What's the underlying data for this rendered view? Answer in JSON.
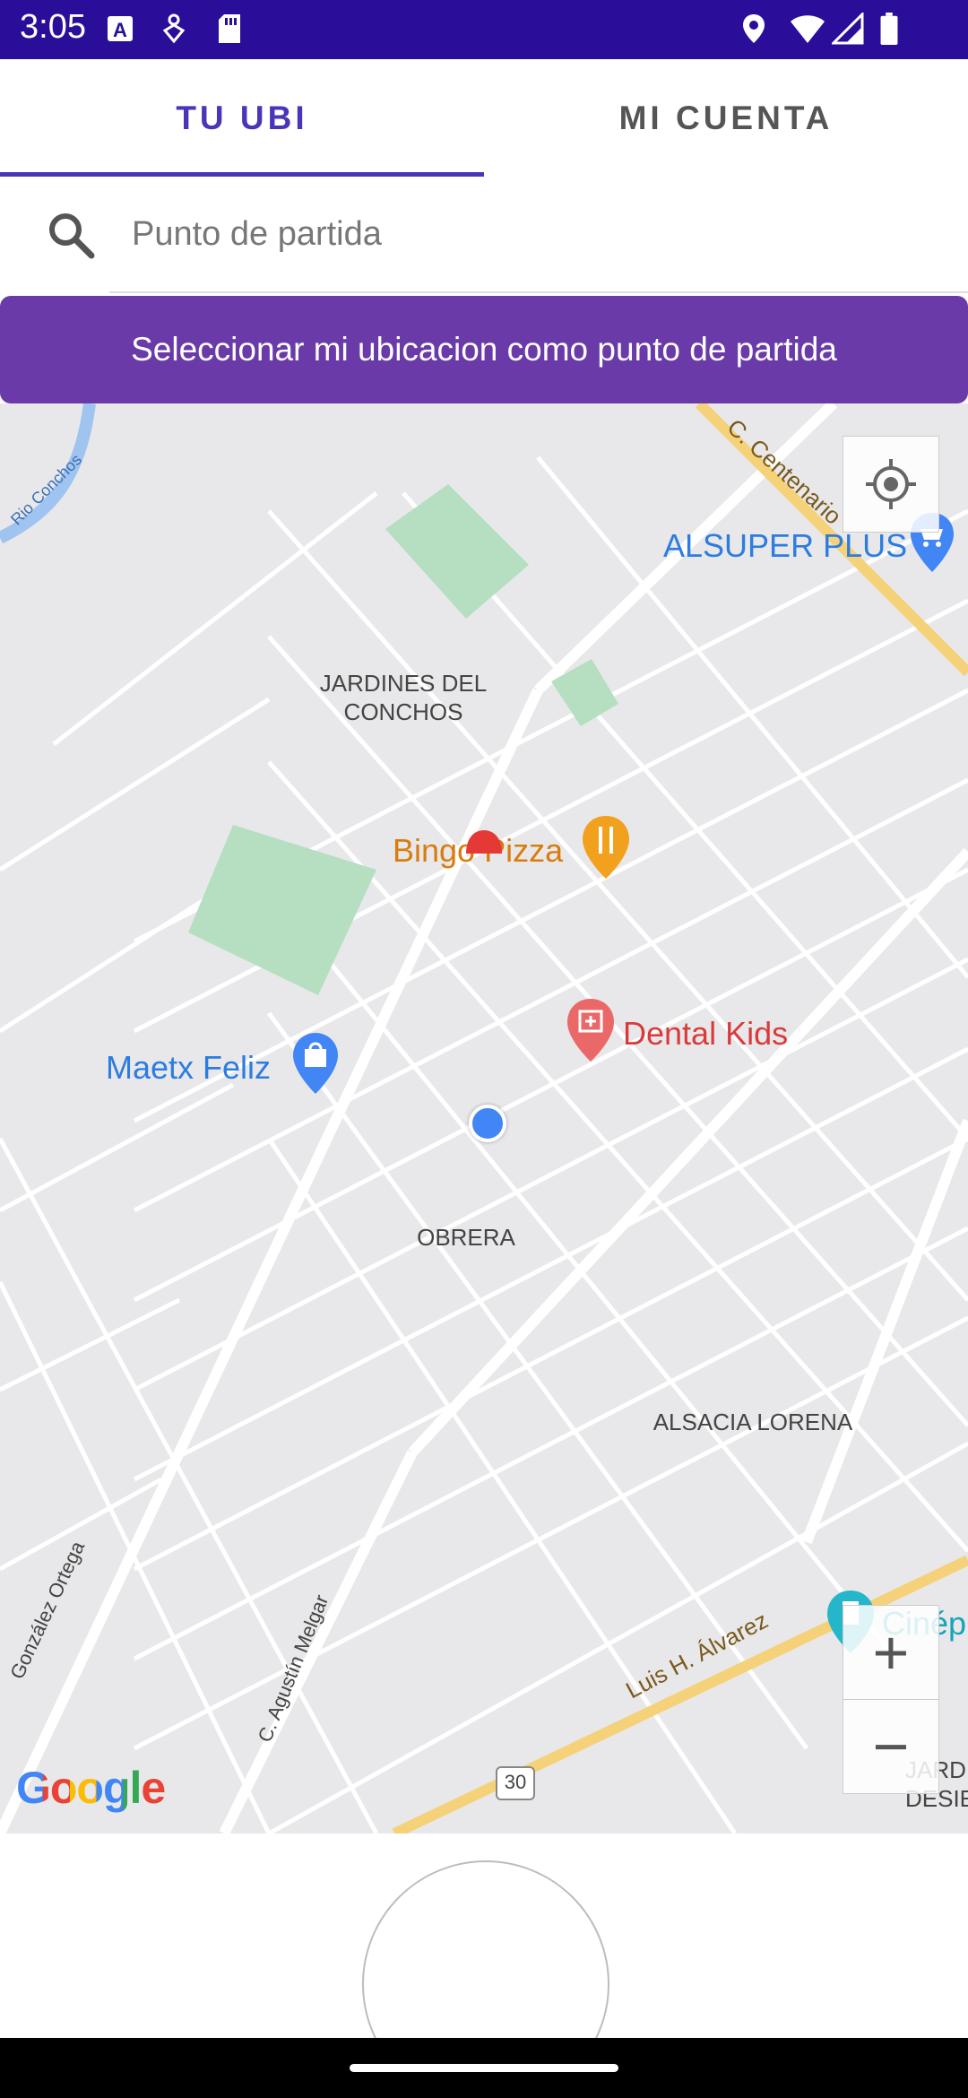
{
  "status_bar": {
    "time": "3:05",
    "icons_left": [
      "keyboard-a-icon",
      "hand-icon",
      "sd-card-icon"
    ],
    "icons_right": [
      "location-icon",
      "wifi-icon",
      "signal-icon",
      "battery-icon"
    ],
    "color": "#2a0e9a"
  },
  "tabs": {
    "items": [
      {
        "label": "TU UBI",
        "active": true
      },
      {
        "label": "MI CUENTA",
        "active": false
      }
    ],
    "accent": "#4a35b8"
  },
  "search": {
    "placeholder": "Punto de partida",
    "value": ""
  },
  "select_button": {
    "label": "Seleccionar mi ubicacion como punto de partida",
    "color": "#6a3ba8"
  },
  "map": {
    "neighborhoods": {
      "jardines_line1": "JARDINES DEL",
      "jardines_line2": "CONCHOS",
      "obrera": "OBRERA",
      "alsacia": "ALSACIA LORENA",
      "jardin_line1": "JARDIN",
      "jardin_line2": "DESIE"
    },
    "streets": {
      "rio": "Rio Conchos",
      "centenario": "C. Centenario",
      "gonzalez": "González Ortega",
      "agustin": "C. Agustín Melgar",
      "luis": "Luis H. Álvarez",
      "route": "30"
    },
    "pois": {
      "alsuper": "ALSUPER PLUS",
      "bingo": "Bingo Pizza",
      "dental": "Dental Kids",
      "maetx": "Maetx Feliz",
      "cinepolis": "Cinép"
    },
    "controls": {
      "zoom_in": "+",
      "zoom_out": "−"
    },
    "attribution": "Google"
  }
}
